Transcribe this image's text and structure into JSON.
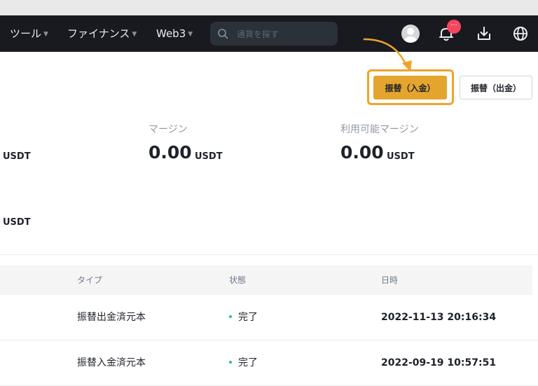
{
  "nav": {
    "items": [
      {
        "label": "ツール"
      },
      {
        "label": "ファイナンス"
      },
      {
        "label": "Web3"
      }
    ],
    "search": {
      "placeholder": "通貨を探す"
    },
    "notification_badge": "···"
  },
  "actions": {
    "deposit_label": "振替（入金）",
    "withdraw_label": "振替（出金）"
  },
  "balances": {
    "left_unit_1": "USDT",
    "left_unit_2": "USDT",
    "margin": {
      "label": "マージン",
      "value": "0.00",
      "unit": "USDT"
    },
    "available_margin": {
      "label": "利用可能マージン",
      "value": "0.00",
      "unit": "USDT"
    }
  },
  "table": {
    "headers": {
      "type": "タイプ",
      "status": "状態",
      "datetime": "日時"
    },
    "rows": [
      {
        "type": "振替出金済元本",
        "status": "完了",
        "datetime": "2022-11-13 20:16:34"
      },
      {
        "type": "振替入金済元本",
        "status": "完了",
        "datetime": "2022-09-19 10:57:51"
      }
    ]
  },
  "colors": {
    "accent": "#e4a52f",
    "highlight": "#f0a32a",
    "success": "#2ebd85",
    "nav_bg": "#181a20"
  }
}
